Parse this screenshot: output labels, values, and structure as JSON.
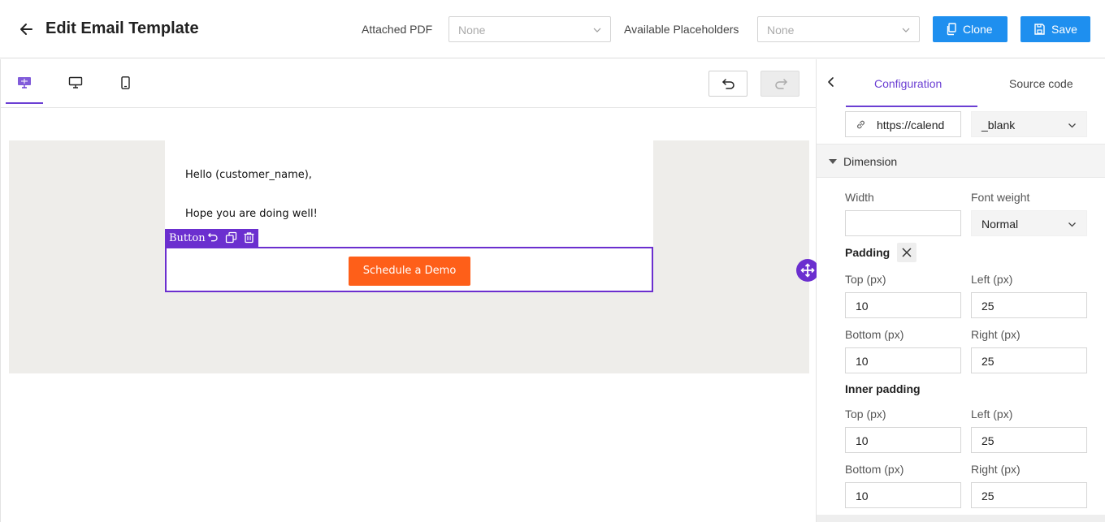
{
  "header": {
    "title": "Edit Email Template",
    "attached_pdf_label": "Attached PDF",
    "attached_pdf_value": "None",
    "placeholders_label": "Available Placeholders",
    "placeholders_value": "None",
    "clone_label": "Clone",
    "save_label": "Save"
  },
  "toolbar": {
    "views": [
      "desktop-preview",
      "desktop",
      "mobile"
    ],
    "active_view": "desktop-preview"
  },
  "email": {
    "line1": "Hello (customer_name),",
    "line2": "Hope you are doing well!",
    "button_text": "Schedule a Demo",
    "block_tag": "Button"
  },
  "panel": {
    "tabs": [
      {
        "label": "Configuration",
        "active": true
      },
      {
        "label": "Source code",
        "active": false
      }
    ],
    "link_url": "https://calend",
    "link_target": "_blank",
    "section_title": "Dimension",
    "width_label": "Width",
    "width_value": "",
    "font_weight_label": "Font weight",
    "font_weight_value": "Normal",
    "padding_label": "Padding",
    "padding": {
      "top_label": "Top (px)",
      "top": "10",
      "left_label": "Left (px)",
      "left": "25",
      "bottom_label": "Bottom (px)",
      "bottom": "10",
      "right_label": "Right (px)",
      "right": "25"
    },
    "inner_padding_label": "Inner padding",
    "inner_padding": {
      "top_label": "Top (px)",
      "top": "10",
      "left_label": "Left (px)",
      "left": "25",
      "bottom_label": "Bottom (px)",
      "bottom": "10",
      "right_label": "Right (px)",
      "right": "25"
    }
  },
  "colors": {
    "accent": "#6b2fcf",
    "primary_button": "#1e8fef",
    "cta": "#fe5f19",
    "canvas_bg": "#eeedea"
  }
}
